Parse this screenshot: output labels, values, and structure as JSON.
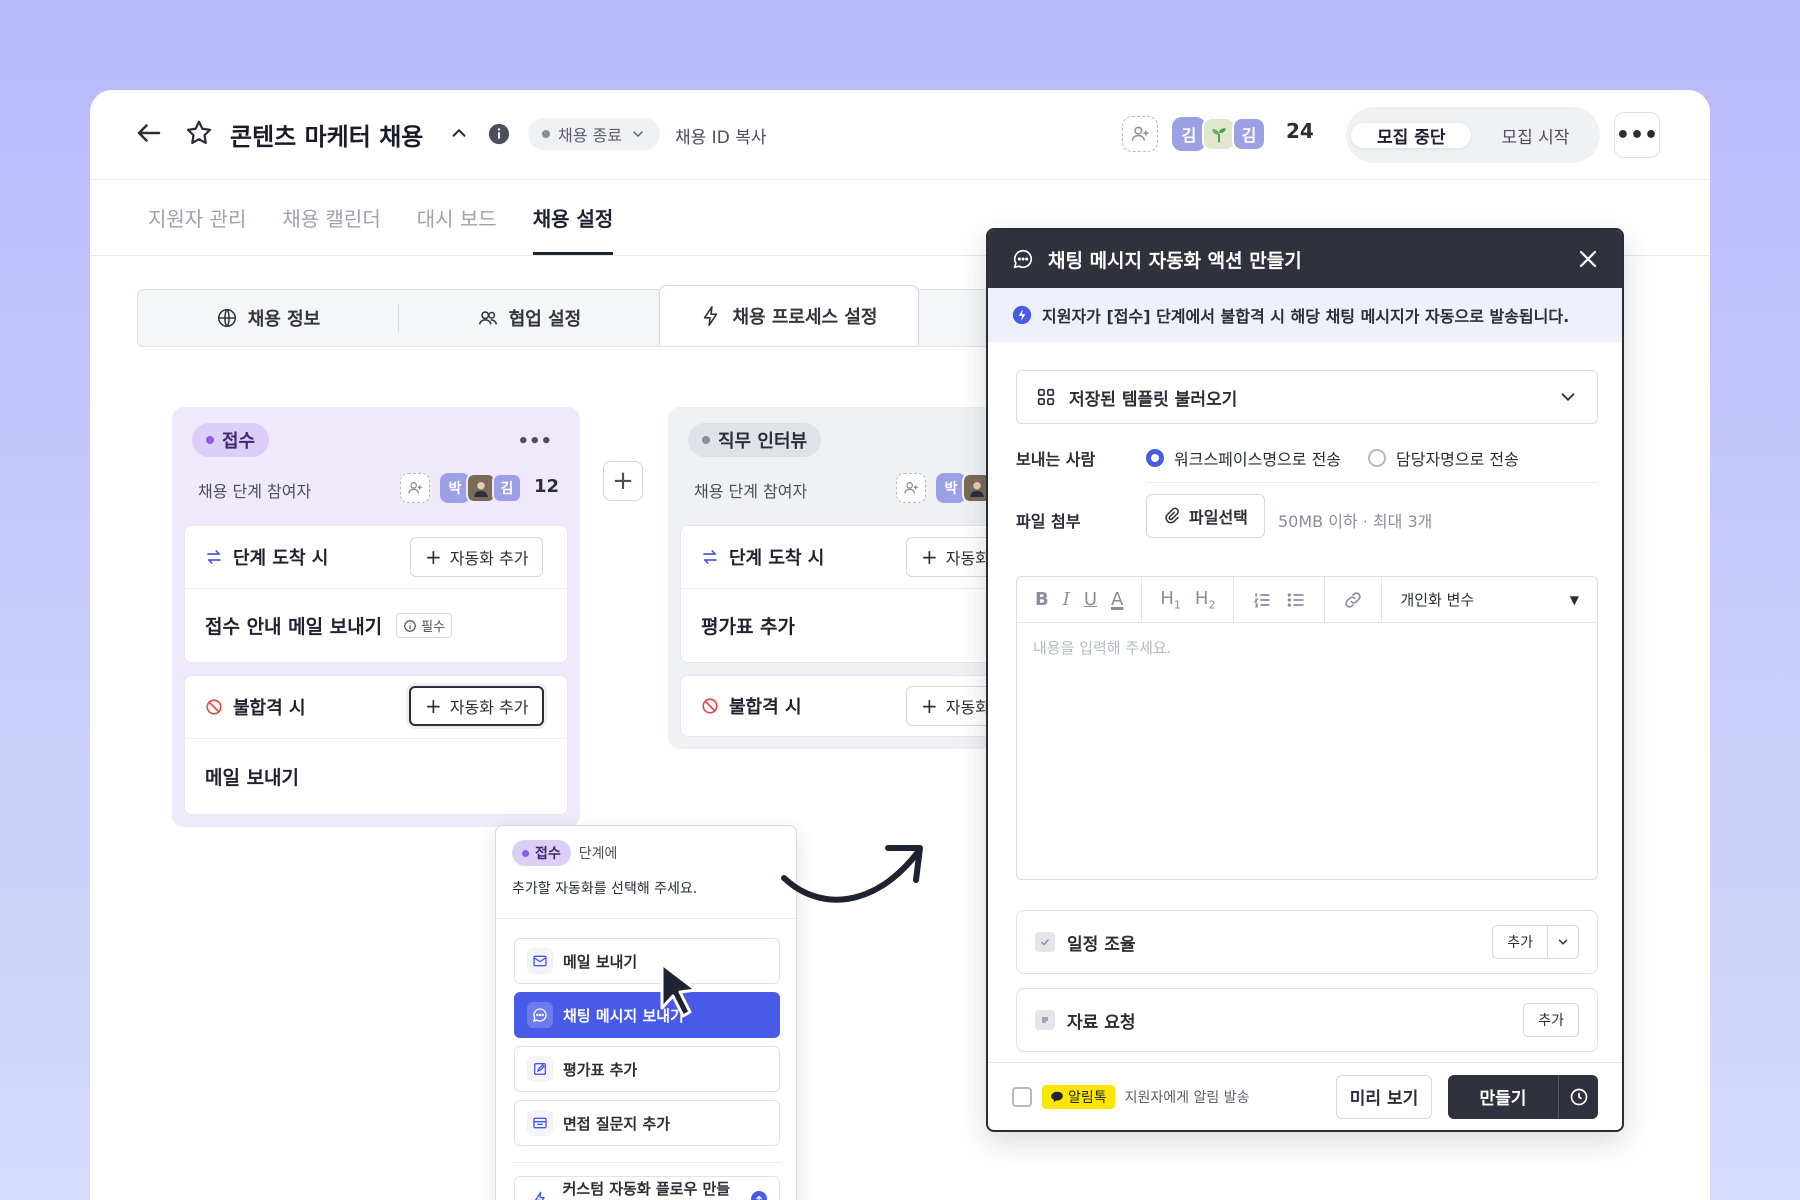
{
  "header": {
    "title": "콘텐츠 마케터 채용",
    "status_label": "채용 종료",
    "copy_id_label": "채용 ID 복사",
    "avatars": [
      "김",
      "김"
    ],
    "member_count": "24",
    "seg_stop": "모집 중단",
    "seg_start": "모집 시작"
  },
  "nav": {
    "tabs": [
      "지원자 관리",
      "채용 캘린더",
      "대시 보드",
      "채용 설정"
    ]
  },
  "subtabs": {
    "info": "채용 정보",
    "collab": "협업 설정",
    "process": "채용 프로세스 설정"
  },
  "stage1": {
    "name": "접수",
    "participants_label": "채용 단계 참여자",
    "avatar": "박",
    "avatar2": "김",
    "count": "12",
    "arrive_label": "단계 도착 시",
    "add_automation": "자동화 추가",
    "arrive_action": "접수 안내 메일 보내기",
    "required": "필수",
    "reject_label": "불합격 시",
    "reject_action": "메일 보내기"
  },
  "stage2": {
    "name": "직무 인터뷰",
    "participants_label": "채용 단계 참여자",
    "avatar": "박",
    "arrive_label": "단계 도착 시",
    "add_automation": "자동화",
    "arrive_action": "평가표 추가",
    "reject_label": "불합격 시"
  },
  "popup": {
    "chip": "접수",
    "chip_suffix": "단계에",
    "instruction": "추가할 자동화를 선택해 주세요.",
    "items": [
      "메일 보내기",
      "채팅 메시지 보내기",
      "평가표 추가",
      "면접 질문지 추가"
    ],
    "custom": "커스텀 자동화 플로우 만들기"
  },
  "modal": {
    "title": "채팅 메시지 자동화 액션 만들기",
    "info": "지원자가 [접수] 단계에서 불합격 시 해당 채팅 메시지가 자동으로 발송됩니다.",
    "template_label": "저장된 템플릿 불러오기",
    "sender_label": "보내는 사람",
    "sender_opt1": "워크스페이스명으로 전송",
    "sender_opt2": "담당자명으로 전송",
    "attach_label": "파일 첨부",
    "file_button": "파일선택",
    "file_hint": "50MB 이하 · 최대 3개",
    "personalize": "개인화 변수",
    "editor_placeholder": "내용을 입력해 주세요.",
    "schedule_label": "일정 조율",
    "request_label": "자료 요청",
    "add": "추가",
    "kakao": "알림톡",
    "notify_text": "지원자에게 알림 발송",
    "preview": "미리 보기",
    "create": "만들기"
  },
  "colors": {
    "accent": "#4a5ae8",
    "dark": "#2f323c",
    "purple": "#8b5ce6"
  }
}
